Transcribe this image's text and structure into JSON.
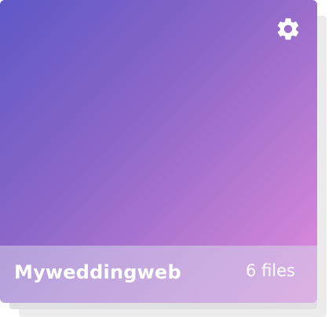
{
  "album": {
    "title": "Myweddingweb",
    "file_count": "6 files",
    "settings_icon": "gear-icon",
    "cover_gradient": [
      "#5f58c6",
      "#8c67c9",
      "#d487d9"
    ]
  }
}
